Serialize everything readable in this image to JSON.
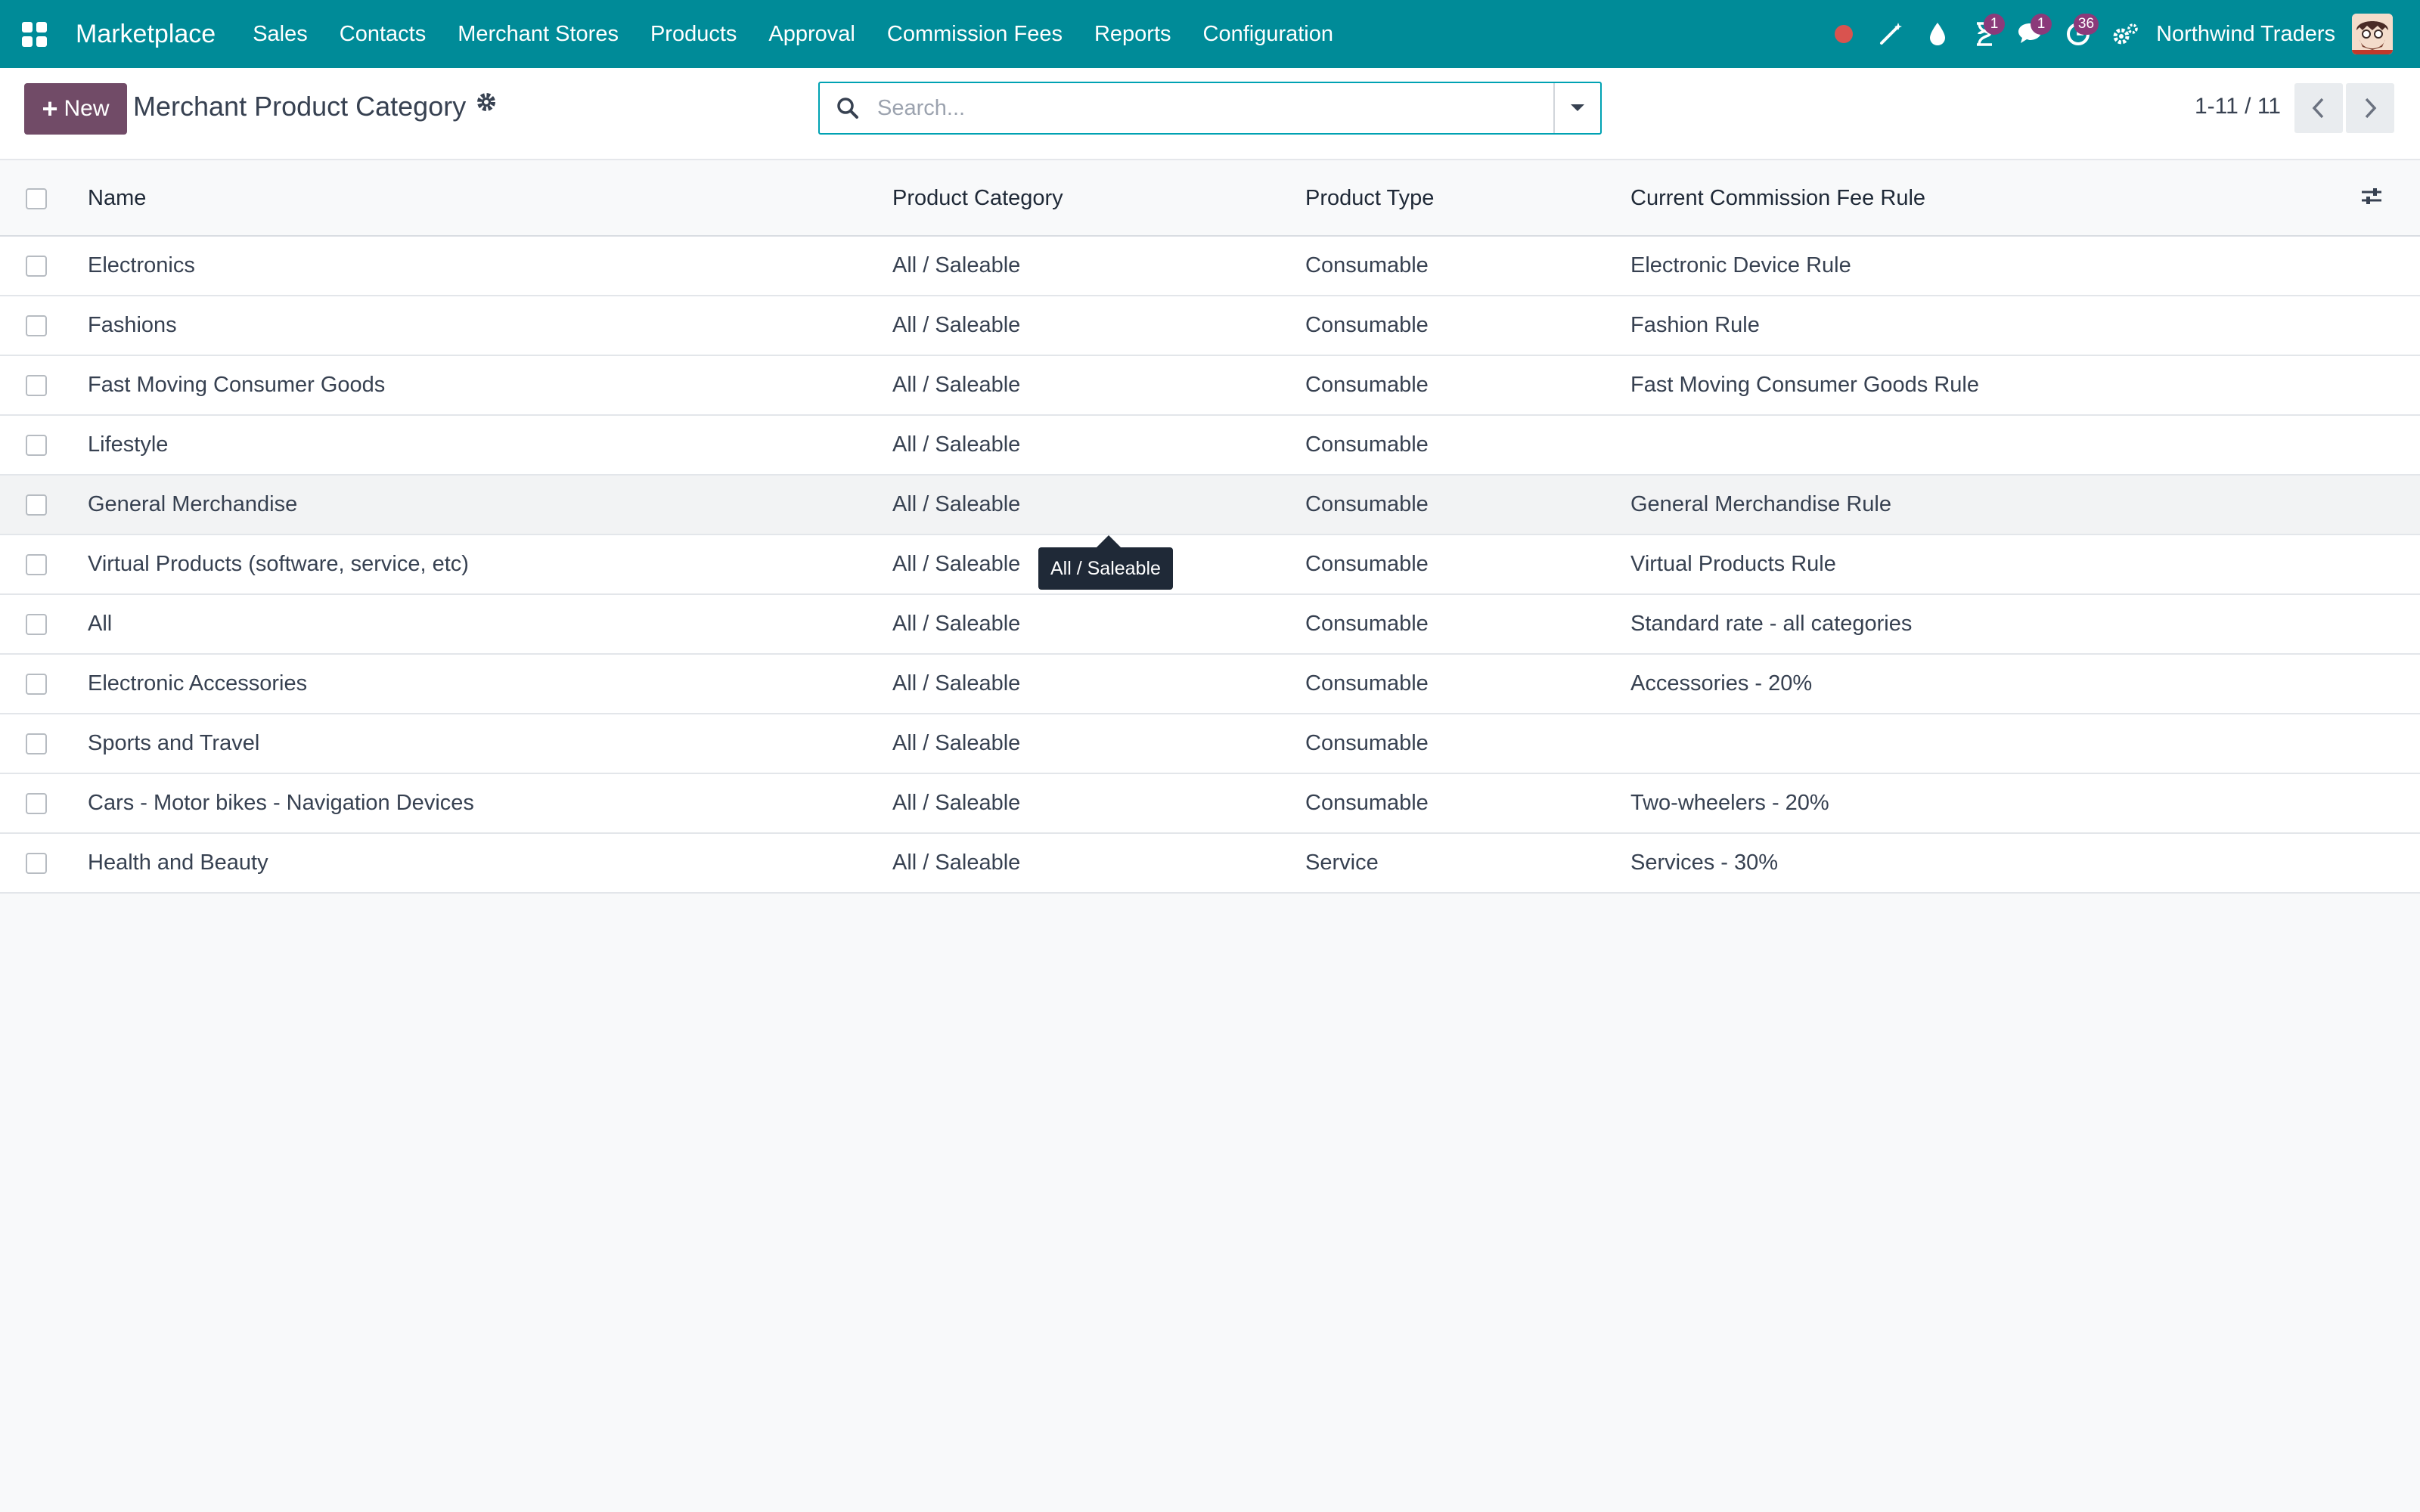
{
  "navbar": {
    "brand": "Marketplace",
    "menu": [
      "Sales",
      "Contacts",
      "Merchant Stores",
      "Products",
      "Approval",
      "Commission Fees",
      "Reports",
      "Configuration"
    ],
    "badges": {
      "activities": "1",
      "messages": "1",
      "updates": "36"
    },
    "company": "Northwind Traders"
  },
  "control_panel": {
    "new_label": "New",
    "title": "Merchant Product Category",
    "search_placeholder": "Search...",
    "pager": "1-11 / 11"
  },
  "table": {
    "headers": [
      "Name",
      "Product Category",
      "Product Type",
      "Current Commission Fee Rule"
    ],
    "rows": [
      {
        "name": "Electronics",
        "category": "All / Saleable",
        "type": "Consumable",
        "rule": "Electronic Device Rule"
      },
      {
        "name": "Fashions",
        "category": "All / Saleable",
        "type": "Consumable",
        "rule": "Fashion Rule"
      },
      {
        "name": "Fast Moving Consumer Goods",
        "category": "All / Saleable",
        "type": "Consumable",
        "rule": "Fast Moving Consumer Goods Rule"
      },
      {
        "name": "Lifestyle",
        "category": "All / Saleable",
        "type": "Consumable",
        "rule": ""
      },
      {
        "name": "General Merchandise",
        "category": "All / Saleable",
        "type": "Consumable",
        "rule": "General Merchandise Rule"
      },
      {
        "name": "Virtual Products (software, service, etc)",
        "category": "All / Saleable",
        "type": "Consumable",
        "rule": "Virtual Products Rule"
      },
      {
        "name": "All",
        "category": "All / Saleable",
        "type": "Consumable",
        "rule": "Standard rate - all categories"
      },
      {
        "name": "Electronic Accessories",
        "category": "All / Saleable",
        "type": "Consumable",
        "rule": "Accessories - 20%"
      },
      {
        "name": "Sports and Travel",
        "category": "All / Saleable",
        "type": "Consumable",
        "rule": ""
      },
      {
        "name": "Cars - Motor bikes - Navigation Devices",
        "category": "All / Saleable",
        "type": "Consumable",
        "rule": "Two-wheelers - 20%"
      },
      {
        "name": "Health and Beauty",
        "category": "All / Saleable",
        "type": "Service",
        "rule": "Services - 30%"
      }
    ]
  },
  "tooltip": "All / Saleable",
  "colors": {
    "navbar": "#008b98",
    "primary_button": "#714b67",
    "badge": "#8b3a7a",
    "search_border": "#00a2b3"
  }
}
